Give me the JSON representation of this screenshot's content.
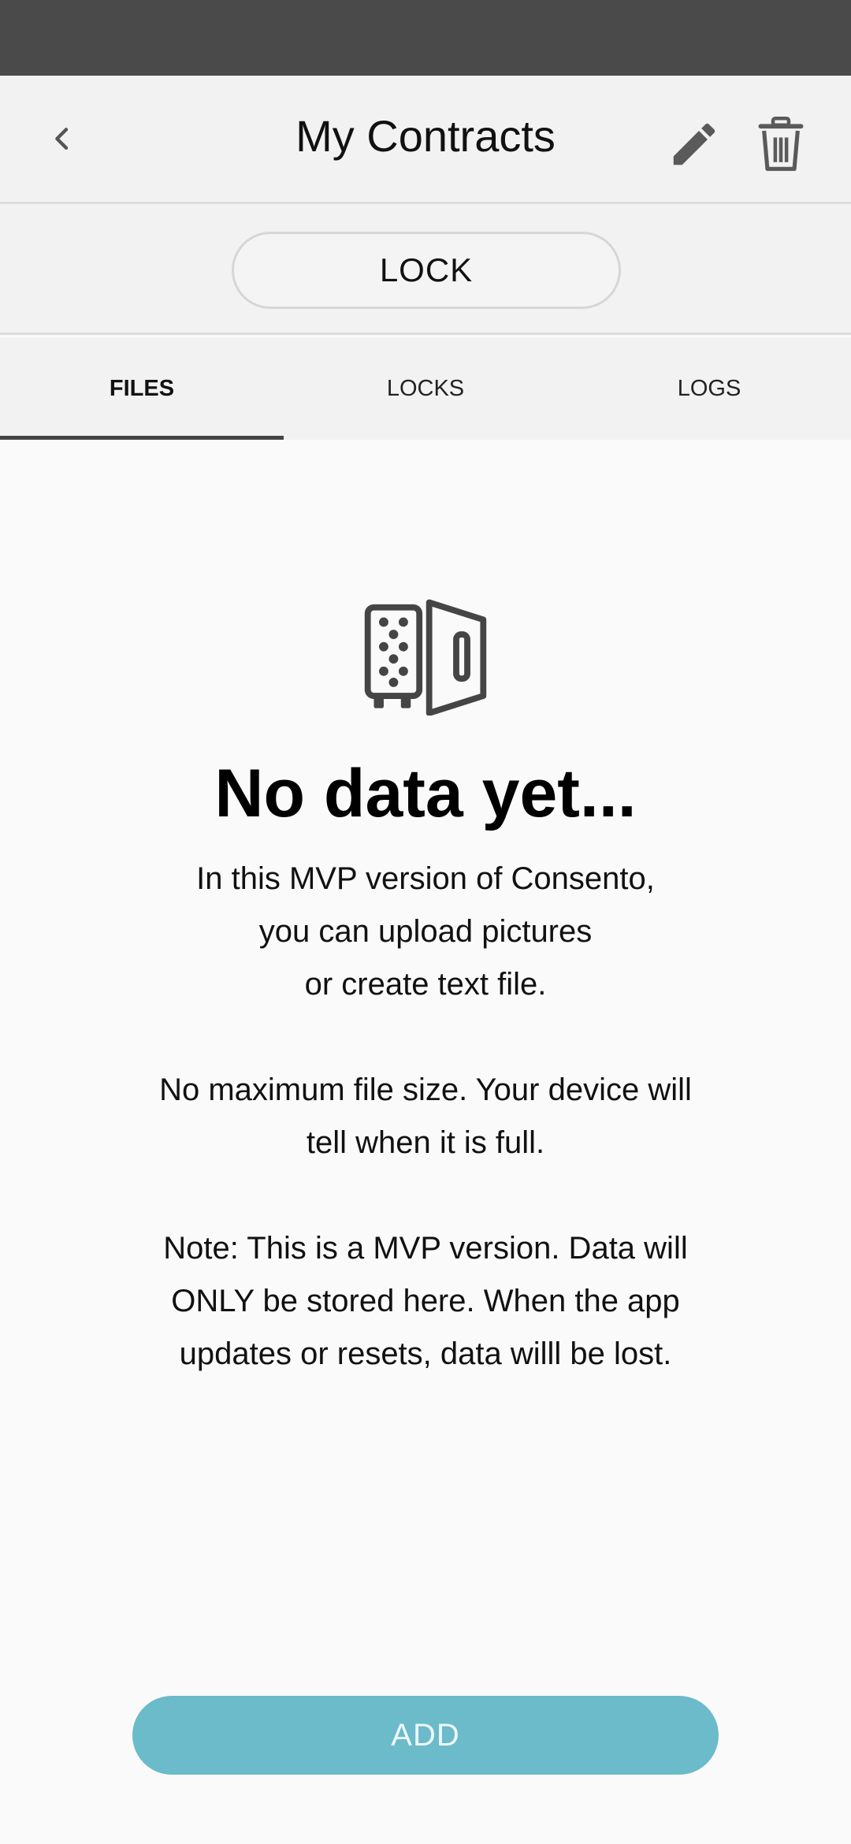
{
  "header": {
    "title": "My Contracts",
    "icons": {
      "back": "chevron-left-icon",
      "edit": "pencil-icon",
      "delete": "trash-icon"
    }
  },
  "lock_button": {
    "label": "LOCK"
  },
  "tabs": [
    {
      "label": "FILES",
      "active": true
    },
    {
      "label": "LOCKS",
      "active": false
    },
    {
      "label": "LOGS",
      "active": false
    }
  ],
  "empty_state": {
    "icon": "vault-icon",
    "title": "No data yet...",
    "paragraph1": "In this MVP version of Consento,\nyou can upload pictures\nor create text file.",
    "paragraph2": "No maximum file size. Your device will\ntell when it is full.",
    "paragraph3": "Note: This is a MVP version.  Data will\nONLY be stored here. When the app\nupdates or resets, data willl be lost."
  },
  "add_button": {
    "label": "ADD"
  },
  "colors": {
    "status_bar": "#4a4a4a",
    "app_bar": "#f2f2f2",
    "accent": "#6bbbca",
    "background": "#fafafa"
  }
}
